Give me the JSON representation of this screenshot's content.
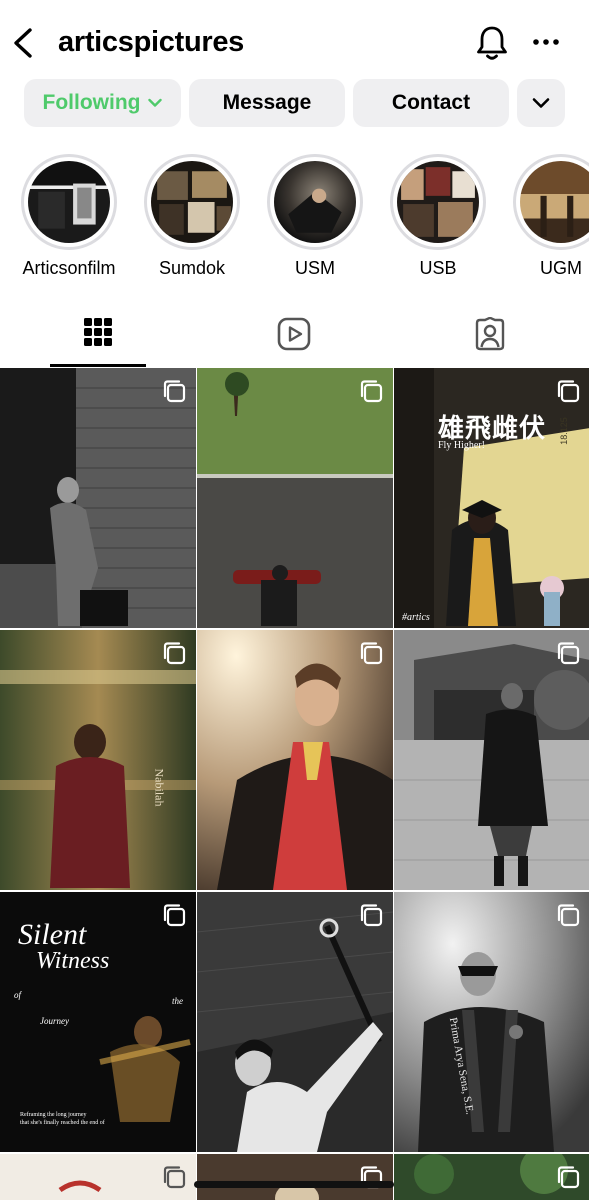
{
  "header": {
    "username": "articspictures",
    "icons": {
      "back": "chevron-left-icon",
      "bell": "bell-icon",
      "more": "more-horizontal-icon"
    }
  },
  "actions": {
    "following_label": "Following",
    "message_label": "Message",
    "contact_label": "Contact"
  },
  "highlights": [
    {
      "label": "Articsonfilm"
    },
    {
      "label": "Sumdok"
    },
    {
      "label": "USM"
    },
    {
      "label": "USB"
    },
    {
      "label": "UGM"
    }
  ],
  "tabs": [
    {
      "name": "posts-grid-icon",
      "active": true
    },
    {
      "name": "reels-icon",
      "active": false
    },
    {
      "name": "tagged-icon",
      "active": false
    }
  ],
  "posts": [
    {
      "caption": ""
    },
    {
      "caption": ""
    },
    {
      "title_cn": "雄飛雌伏",
      "subtitle": "Fly Higher!",
      "watermark": "#artics",
      "date": "18.125"
    },
    {
      "side_text": "Nabilah"
    },
    {
      "caption": ""
    },
    {
      "caption": ""
    },
    {
      "title_line1": "Silent",
      "title_line2": "Witness",
      "small_of": "of",
      "small_the": "the",
      "small_journey": "Journey",
      "footer_line1": "Reframing the long journey",
      "footer_line2": "that she's finally reached the end of"
    },
    {
      "caption": ""
    },
    {
      "sash_text": "Prima Arya Sena, S.E."
    }
  ],
  "colors": {
    "accent_green": "#4fca6b",
    "button_bg": "#efeff1",
    "ring_gray": "#dcdce0"
  }
}
